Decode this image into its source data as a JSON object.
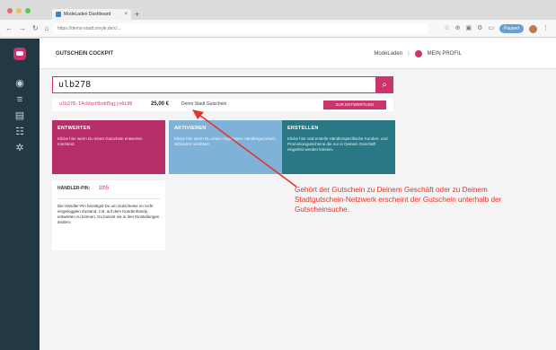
{
  "browser": {
    "tab_title": "ModeLaden Dashboard",
    "tab_close": "×",
    "new_tab": "+",
    "url": "https://demo-stadt.zmyle.de/c/...",
    "paused_label": "Paused"
  },
  "header": {
    "app_title": "GUTSCHEIN COCKPIT",
    "shop_name": "ModeLaden",
    "separator": "|",
    "profile_label": "MEIN PROFIL"
  },
  "search": {
    "value": "ulb278",
    "button_icon": "search-icon"
  },
  "result": {
    "code": "ulb278-14ckbpf8ndd5gjjn6i96",
    "amount": "25,00 €",
    "name": "Demo Stadt Gutschein",
    "action": "ZUR ENTWERTUNG"
  },
  "cards": [
    {
      "title": "ENTWERTEN",
      "text": "Klicke hier wenn Du einen Gutschein entwerten möchtest.",
      "color": "#b52e67"
    },
    {
      "title": "AKTIVIEREN",
      "text": "Klicke hier wenn Du einen eingelösten Händlergutschein aktivieren möchtest.",
      "color": "#7fb2d9"
    },
    {
      "title": "ERSTELLEN",
      "text": "Klicke hier und erstelle Händlerspezifische Kunden- und Promotiongutscheine die nur in Deinem Geschäft eingelöst werden können.",
      "color": "#2a7786"
    }
  ],
  "pin": {
    "label": "HÄNDLER-PIN:",
    "value": "1th5",
    "text": "Die Händler-Pin benötigst Du um Gutscheine im nicht eingeloggten Zustand, z.B. auf dem Kundenhandy, entwerten zu können. Du kannst sie in den Einstellungen ändern."
  },
  "annotation": {
    "text": "Gehört der Gutschein zu Deinem Geschäft oder zu Deinem Stadtgutschein-Netzwerk erscheint der Gutschein unterhalb der Gutscheinsuche.",
    "color": "#e6332a"
  },
  "colors": {
    "brand": "#c9356c",
    "sidebar": "#233845"
  }
}
